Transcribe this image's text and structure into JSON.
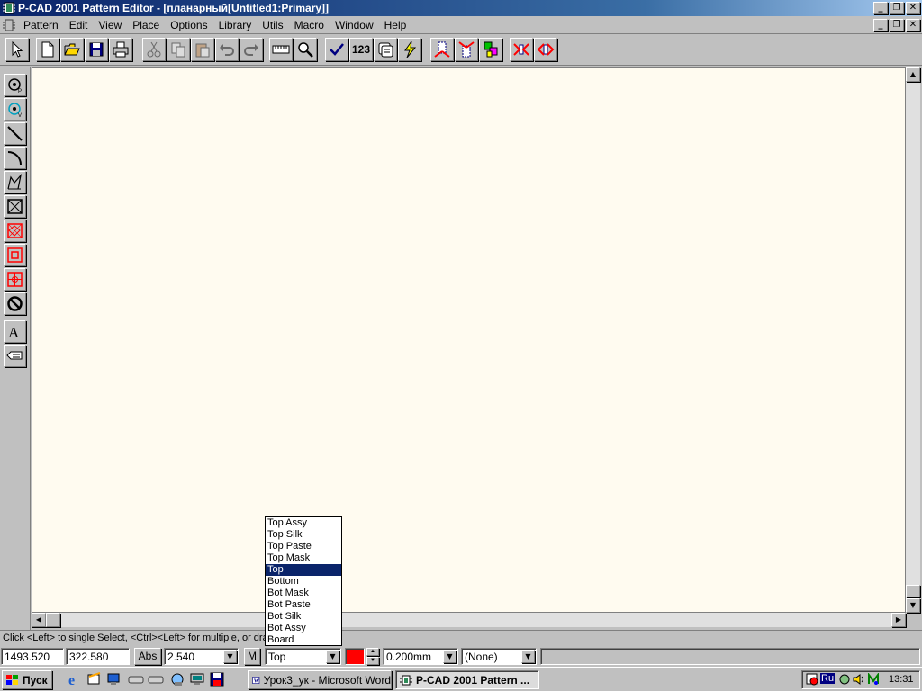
{
  "window": {
    "title": "P-CAD 2001 Pattern Editor - [планарный[Untitled1:Primary]]"
  },
  "menu": [
    "Pattern",
    "Edit",
    "View",
    "Place",
    "Options",
    "Library",
    "Utils",
    "Macro",
    "Window",
    "Help"
  ],
  "toolbar": {
    "renumber_label": "123"
  },
  "status": {
    "hint": "Click <Left> to single Select, <Ctrl><Left> for multiple, or drag f",
    "x": "1493.520",
    "y": "322.580",
    "abs_label": "Abs",
    "grid": "2.540",
    "m_label": "M",
    "layer": "Top",
    "layer_color": "#ff0000",
    "line_width": "0.200mm",
    "net": "(None)"
  },
  "layer_dropdown": {
    "items": [
      "Top Assy",
      "Top Silk",
      "Top Paste",
      "Top Mask",
      "Top",
      "Bottom",
      "Bot Mask",
      "Bot Paste",
      "Bot Silk",
      "Bot Assy",
      "Board"
    ],
    "selected_index": 4
  },
  "taskbar": {
    "start_label": "Пуск",
    "tasks": [
      {
        "label": "Урок3_ук - Microsoft Word",
        "active": false
      },
      {
        "label": "P-CAD 2001 Pattern ...",
        "active": true
      }
    ],
    "tray_lang": "Ru",
    "clock": "13:31"
  },
  "colors": {
    "canvas_bg": "#fffbf0",
    "titlebar": "#0a246a",
    "selection": "#0a246a"
  }
}
